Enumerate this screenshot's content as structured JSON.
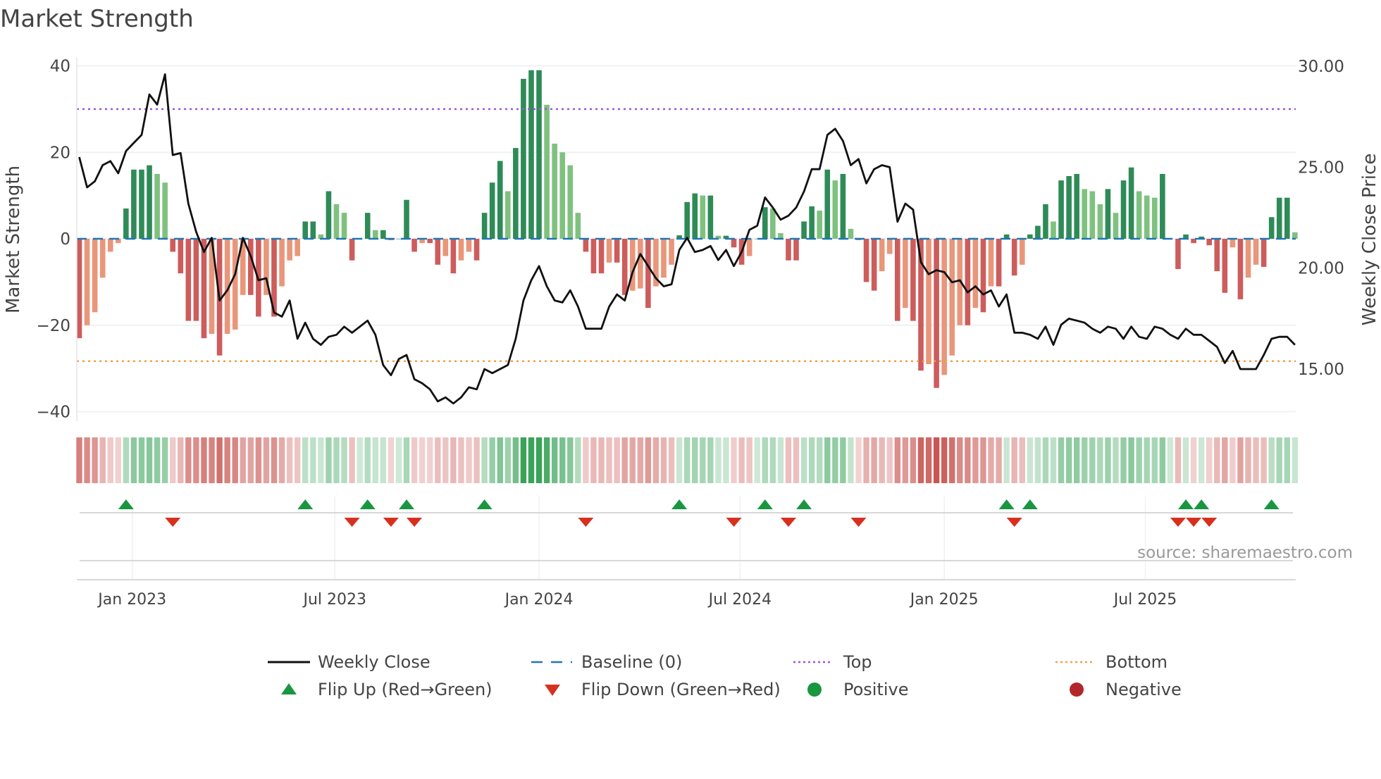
{
  "chart_data": {
    "type": "bar",
    "title": "Market Strength",
    "ylabel": "Market Strength",
    "y2label": "Weekly Close Price",
    "ylim": [
      -40,
      40
    ],
    "yticks": [
      40,
      20,
      0,
      -20,
      -40
    ],
    "yticklabels": [
      "40",
      "20",
      "0",
      "−20",
      "−40"
    ],
    "y2lim": [
      12.87,
      30
    ],
    "y2ticks": [
      30,
      25,
      20,
      15
    ],
    "y2ticklabels": [
      "30.00",
      "25.00",
      "20.00",
      "15.00"
    ],
    "xticks": [
      {
        "label": "Jan 2023",
        "week": 6.8
      },
      {
        "label": "Jul 2023",
        "week": 32.8
      },
      {
        "label": "Jan 2024",
        "week": 59
      },
      {
        "label": "Jul 2024",
        "week": 84.8
      },
      {
        "label": "Jan 2025",
        "week": 111
      },
      {
        "label": "Jul 2025",
        "week": 136.8
      }
    ],
    "top_level": 30,
    "bottom_level": -28.3,
    "baseline": 0,
    "strength": [
      -23,
      -20,
      -17,
      -9,
      -3,
      -1,
      7,
      16,
      16,
      17,
      15,
      13,
      -3,
      -8,
      -19,
      -19,
      -23,
      -22,
      -27,
      -22,
      -21,
      -13,
      -13,
      -18,
      -13,
      -18,
      -11,
      -5,
      -4,
      4,
      4,
      1,
      11,
      8,
      6,
      -5,
      0,
      6,
      2,
      2,
      -0.3,
      0,
      9,
      -3,
      -1,
      -1,
      -6,
      -4,
      -8,
      -5,
      -3,
      -5,
      6,
      13,
      18,
      11,
      21,
      37,
      39,
      39,
      31,
      22,
      20,
      17,
      6,
      -3,
      -8,
      -8,
      -5.5,
      -5.5,
      -13,
      -12,
      -11.5,
      -16,
      -11,
      -9,
      -6,
      0.8,
      8.5,
      10.5,
      10,
      10,
      0.7,
      0.7,
      -2,
      -6,
      -4,
      0,
      7.3,
      7,
      1.3,
      -5,
      -5,
      4,
      7.5,
      6.5,
      16,
      13.5,
      15,
      2.3,
      -0.3,
      -10,
      -12,
      -7.5,
      -3.5,
      -19,
      -16,
      -19,
      -30.5,
      -29,
      -34.5,
      -31.5,
      -27,
      -20,
      -20,
      -16,
      -17,
      -11,
      -11,
      1,
      -8.5,
      -6,
      1,
      3,
      8,
      4,
      13.5,
      14.5,
      15,
      11.5,
      11,
      8,
      11.5,
      6,
      13.5,
      16.5,
      11,
      10,
      9.5,
      15,
      0,
      -7,
      1,
      -1,
      0.5,
      -1.5,
      -7.5,
      -12.5,
      -2,
      -14,
      -9,
      -6,
      -6.5,
      5,
      9.5,
      9.5,
      1.5
    ],
    "weekly_close": [
      25.5,
      24.0,
      24.3,
      25.1,
      25.3,
      24.7,
      25.8,
      26.2,
      26.6,
      28.6,
      28.1,
      29.6,
      25.6,
      25.7,
      23.2,
      21.8,
      20.8,
      21.5,
      18.4,
      18.9,
      19.7,
      21.5,
      20.6,
      19.4,
      19.5,
      17.8,
      17.6,
      18.4,
      16.5,
      17.3,
      16.5,
      16.2,
      16.6,
      16.7,
      17.1,
      16.8,
      17.1,
      17.4,
      16.7,
      15.2,
      14.7,
      15.5,
      15.7,
      14.5,
      14.3,
      14.0,
      13.4,
      13.6,
      13.3,
      13.6,
      14.1,
      14.0,
      15.0,
      14.8,
      15.0,
      15.2,
      16.5,
      18.4,
      19.4,
      20.1,
      19.1,
      18.4,
      18.3,
      18.9,
      18.1,
      17.0,
      17.0,
      17.0,
      18.1,
      18.7,
      18.4,
      19.8,
      20.7,
      20.1,
      19.5,
      19.1,
      19.2,
      20.9,
      21.5,
      20.8,
      20.9,
      21.1,
      20.4,
      20.9,
      20.1,
      20.8,
      21.9,
      22.1,
      23.5,
      23.0,
      22.4,
      22.6,
      23.0,
      23.8,
      24.9,
      24.9,
      26.6,
      26.9,
      26.3,
      25.1,
      25.4,
      24.2,
      24.9,
      25.1,
      25.0,
      22.3,
      23.2,
      22.9,
      20.3,
      19.7,
      19.9,
      19.8,
      19.3,
      19.4,
      18.8,
      19.1,
      18.7,
      18.9,
      18.1,
      18.7,
      16.8,
      16.8,
      16.7,
      16.5,
      17.1,
      16.2,
      17.2,
      17.5,
      17.4,
      17.3,
      17.0,
      16.8,
      17.1,
      17.0,
      16.5,
      17.1,
      16.6,
      16.5,
      17.1,
      17.0,
      16.7,
      16.5,
      17.0,
      16.7,
      16.7,
      16.4,
      16.1,
      15.3,
      15.9,
      15.0,
      15.0,
      15.0,
      15.7,
      16.5,
      16.6,
      16.6,
      16.2
    ],
    "flip_up_weeks": [
      6,
      29,
      37,
      42,
      52,
      77,
      88,
      93,
      119,
      122,
      142,
      144,
      153
    ],
    "flip_down_weeks": [
      12,
      35,
      40,
      43,
      65,
      84,
      91,
      100,
      120,
      141,
      143,
      145
    ],
    "legend": {
      "placement": "bottom",
      "items": [
        {
          "label": "Weekly Close",
          "kind": "line"
        },
        {
          "label": "Baseline (0)",
          "kind": "dash"
        },
        {
          "label": "Top",
          "kind": "dot-purple"
        },
        {
          "label": "Bottom",
          "kind": "dot-orange"
        },
        {
          "label": "Flip Up (Red→Green)",
          "kind": "tri-up"
        },
        {
          "label": "Flip Down (Green→Red)",
          "kind": "tri-down"
        },
        {
          "label": "Positive",
          "kind": "circle-green"
        },
        {
          "label": "Negative",
          "kind": "circle-red"
        }
      ]
    },
    "source": "source: sharemaestro.com",
    "colors": {
      "pos_strong": "#2e8b57",
      "pos_weak": "#7fc17f",
      "neg_strong": "#cd5c5c",
      "neg_weak": "#e9967a",
      "line": "#111111",
      "baseline": "#1f77b4",
      "top": "#9b59d6",
      "bottom": "#f0a050",
      "flip_up": "#1a9641",
      "flip_down": "#d7301f",
      "positive": "#1a9641",
      "negative": "#b2282a"
    }
  }
}
